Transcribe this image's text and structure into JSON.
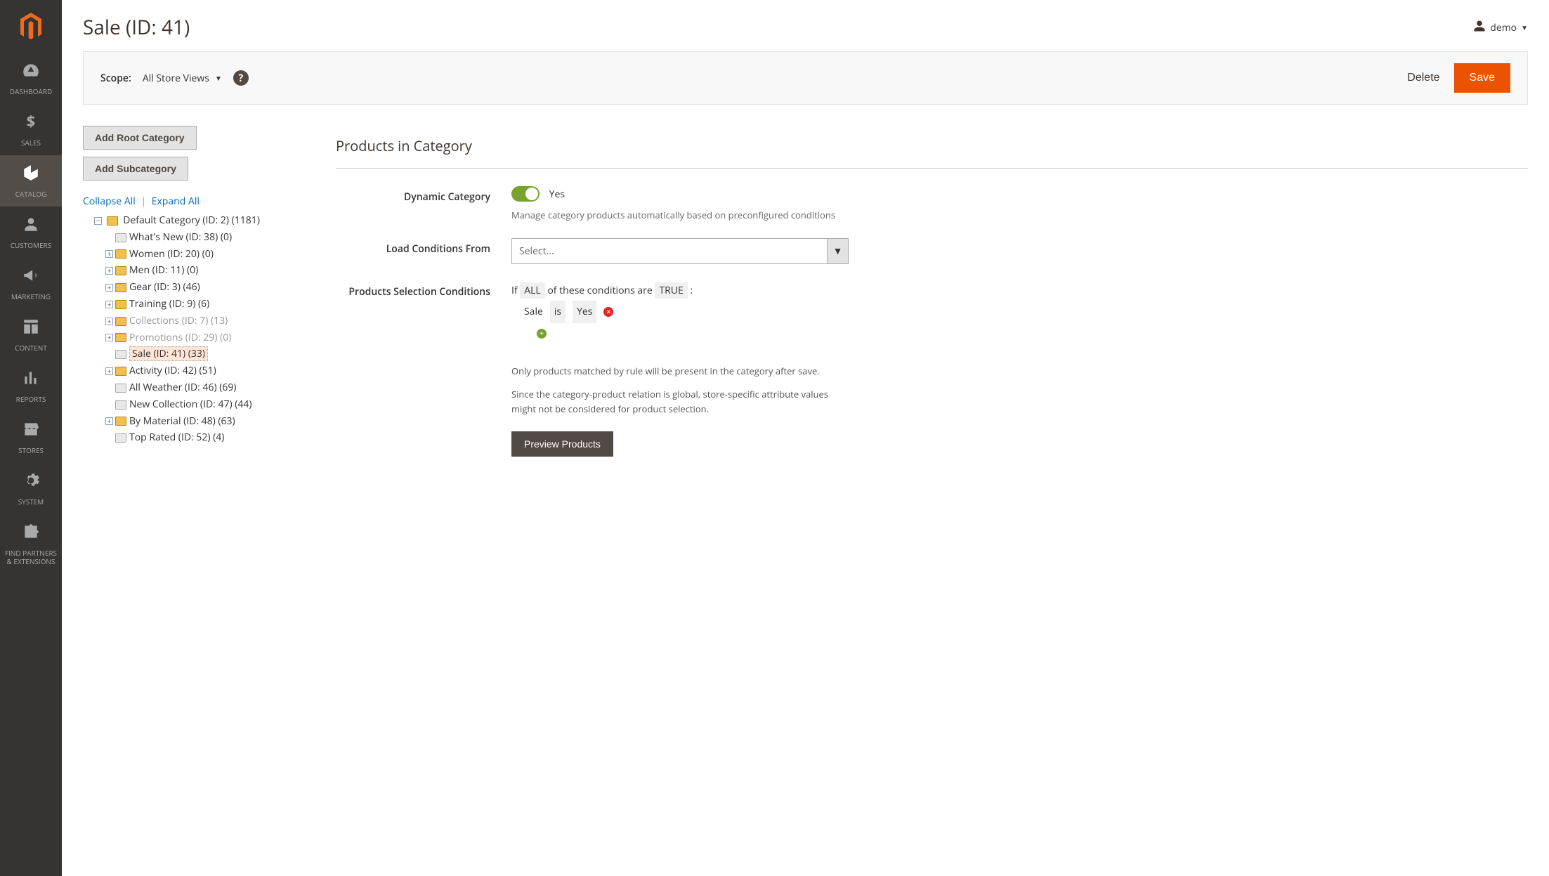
{
  "header": {
    "page_title": "Sale (ID: 41)",
    "username": "demo"
  },
  "sidebar": {
    "items": [
      {
        "slug": "dashboard",
        "label": "DASHBOARD",
        "iconGlyph": "speed"
      },
      {
        "slug": "sales",
        "label": "SALES",
        "iconGlyph": "dollar"
      },
      {
        "slug": "catalog",
        "label": "CATALOG",
        "iconGlyph": "box",
        "active": true
      },
      {
        "slug": "customers",
        "label": "CUSTOMERS",
        "iconGlyph": "person"
      },
      {
        "slug": "marketing",
        "label": "MARKETING",
        "iconGlyph": "megaphone"
      },
      {
        "slug": "content",
        "label": "CONTENT",
        "iconGlyph": "layout"
      },
      {
        "slug": "reports",
        "label": "REPORTS",
        "iconGlyph": "bars"
      },
      {
        "slug": "stores",
        "label": "STORES",
        "iconGlyph": "store"
      },
      {
        "slug": "system",
        "label": "SYSTEM",
        "iconGlyph": "gear"
      },
      {
        "slug": "partners",
        "label": "FIND PARTNERS & EXTENSIONS",
        "iconGlyph": "puzzle"
      }
    ]
  },
  "scope": {
    "label": "Scope:",
    "value": "All Store Views"
  },
  "actions": {
    "delete_label": "Delete",
    "save_label": "Save"
  },
  "left": {
    "add_root_label": "Add Root Category",
    "add_sub_label": "Add Subcategory",
    "collapse_label": "Collapse All",
    "expand_label": "Expand All"
  },
  "tree": {
    "root": {
      "label": "Default Category (ID: 2) (1181)"
    },
    "children": [
      {
        "label": "What's New (ID: 38) (0)",
        "leaf": true
      },
      {
        "label": "Women (ID: 20) (0)",
        "expandable": true
      },
      {
        "label": "Men (ID: 11) (0)",
        "expandable": true
      },
      {
        "label": "Gear (ID: 3) (46)",
        "expandable": true
      },
      {
        "label": "Training (ID: 9) (6)",
        "expandable": true
      },
      {
        "label": "Collections (ID: 7) (13)",
        "expandable": true,
        "inactive": true
      },
      {
        "label": "Promotions (ID: 29) (0)",
        "expandable": true,
        "inactive": true
      },
      {
        "label": "Sale (ID: 41) (33)",
        "leaf": true,
        "selected": true
      },
      {
        "label": "Activity (ID: 42) (51)",
        "expandable": true
      },
      {
        "label": "All Weather (ID: 46) (69)",
        "leaf": true
      },
      {
        "label": "New Collection (ID: 47) (44)",
        "leaf": true
      },
      {
        "label": "By Material (ID: 48) (63)",
        "expandable": true
      },
      {
        "label": "Top Rated (ID: 52) (4)",
        "leaf": true
      }
    ]
  },
  "section": {
    "title": "Products in Category"
  },
  "form": {
    "dynamic_label": "Dynamic Category",
    "dynamic_value_text": "Yes",
    "dynamic_note": "Manage category products automatically based on preconfigured conditions",
    "load_label": "Load Conditions From",
    "load_placeholder": "Select...",
    "psc_label": "Products Selection Conditions",
    "rule_prefix": "If",
    "rule_aggregator": "ALL",
    "rule_mid": "of these conditions are",
    "rule_value": "TRUE",
    "condition_attr": "Sale",
    "condition_op": "is",
    "condition_val": "Yes",
    "note1": "Only products matched by rule will be present in the category after save.",
    "note2": "Since the category-product relation is global, store-specific attribute values might not be considered for product selection.",
    "preview_label": "Preview Products"
  }
}
